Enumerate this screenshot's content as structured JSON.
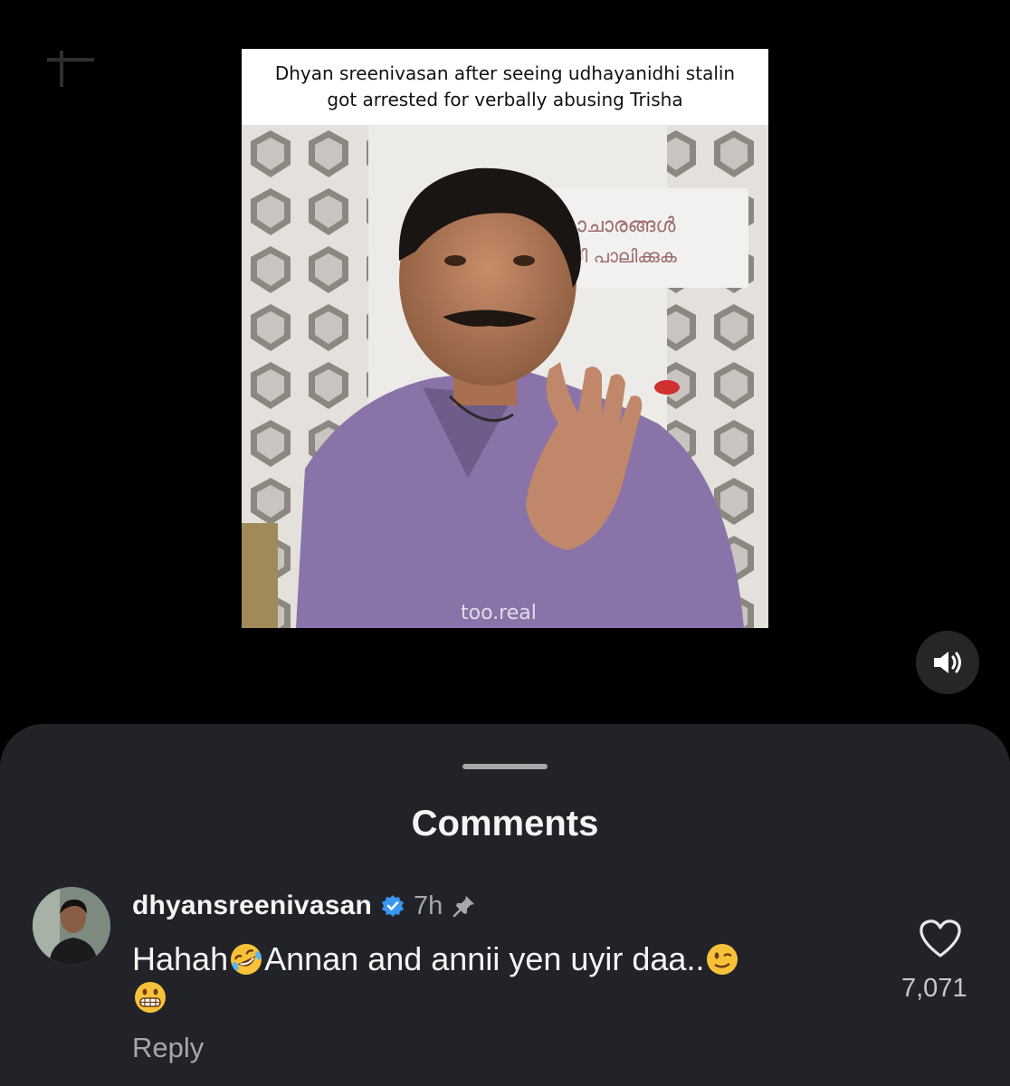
{
  "video": {
    "caption_line1": "Dhyan sreenivasan after seeing udhayanidhi stalin",
    "caption_line2": "got arrested for verbally abusing Trisha",
    "sign_text_line1": "ാചാരങ്ങൾ",
    "sign_text_line2": "ി പാലിക്കുക",
    "watermark": "too.real",
    "sound_icon": "speaker-icon"
  },
  "comments": {
    "title": "Comments",
    "items": [
      {
        "username": "dhyansreenivasan",
        "verified": true,
        "time": "7h",
        "pinned": true,
        "text_part1": "Hahah",
        "emoji1": "rofl-emoji",
        "text_part2": "Annan and annii yen uyir daa..",
        "emoji2": "wink-emoji",
        "emoji3": "grimace-emoji",
        "reply_label": "Reply",
        "like_count": "7,071"
      }
    ]
  },
  "colors": {
    "background": "#000000",
    "sheet": "#212328",
    "verified": "#3897f0",
    "muted_text": "#a8a8a8"
  }
}
